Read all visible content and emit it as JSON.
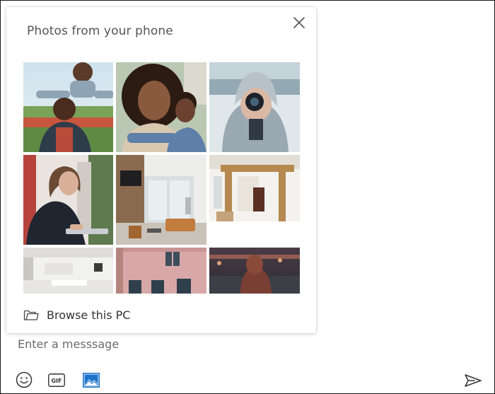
{
  "popup": {
    "title": "Photos from your phone",
    "close_label": "Close",
    "browse_label": "Browse this PC"
  },
  "photos": [
    {
      "label": "Father and son outdoors"
    },
    {
      "label": "Two children smiling"
    },
    {
      "label": "Person with camera in snow"
    },
    {
      "label": "Woman working at laptop"
    },
    {
      "label": "Modern living room"
    },
    {
      "label": "Bright open interior"
    },
    {
      "label": "White interior hallway"
    },
    {
      "label": "Pink building facade"
    },
    {
      "label": "Person in city at dusk"
    }
  ],
  "composer": {
    "placeholder": "Enter a messsage",
    "gif_label": "GIF"
  },
  "icons": {
    "close": "close-icon",
    "folder": "folder-icon",
    "emoji": "emoji-icon",
    "gif": "gif-icon",
    "image": "image-icon",
    "send": "send-icon"
  },
  "colors": {
    "accent": "#1a73c8",
    "text": "#333333",
    "muted": "#6b6b6b"
  }
}
